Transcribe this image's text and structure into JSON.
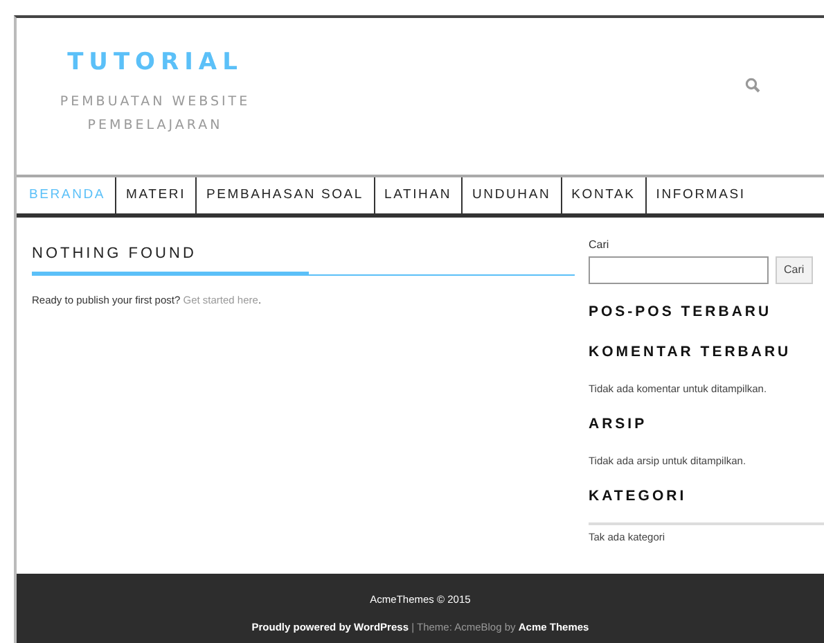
{
  "site": {
    "title": "TUTORIAL",
    "tagline": "PEMBUATAN WEBSITE PEMBELAJARAN"
  },
  "nav": [
    {
      "label": "BERANDA",
      "selected": true
    },
    {
      "label": "MATERI",
      "selected": false
    },
    {
      "label": "PEMBAHASAN SOAL",
      "selected": false
    },
    {
      "label": "LATIHAN",
      "selected": false
    },
    {
      "label": "UNDUHAN",
      "selected": false
    },
    {
      "label": "KONTAK",
      "selected": false
    },
    {
      "label": "INFORMASI",
      "selected": false
    }
  ],
  "main": {
    "heading": "NOTHING FOUND",
    "text": "Ready to publish your first post?",
    "link": "Get started here",
    "after": "."
  },
  "sidebar": {
    "search_label": "Cari",
    "search_button": "Cari",
    "widgets": [
      {
        "title": "POS-POS TERBARU"
      },
      {
        "title": "KOMENTAR TERBARU",
        "text": "Tidak ada komentar untuk ditampilkan."
      },
      {
        "title": "ARSIP",
        "text": "Tidak ada arsip untuk ditampilkan."
      },
      {
        "title": "KATEGORI",
        "text": "Tak ada kategori",
        "divider": true
      }
    ]
  },
  "footer": {
    "copyright": "AcmeThemes © 2015",
    "powered": "Proudly powered by WordPress",
    "theme_text": "| Theme: AcmeBlog by",
    "author": "Acme Themes"
  }
}
